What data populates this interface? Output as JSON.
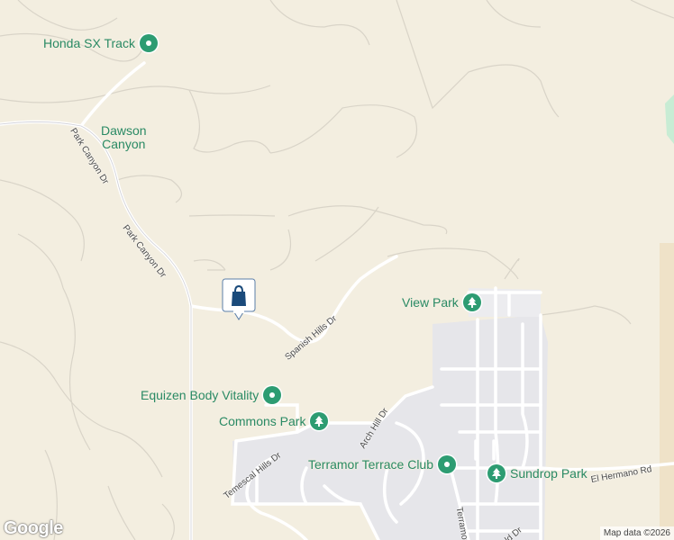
{
  "pois": [
    {
      "id": "honda-sx-track",
      "label": "Honda SX Track",
      "icon": "pin-icon"
    },
    {
      "id": "view-park",
      "label": "View Park",
      "icon": "tree-icon"
    },
    {
      "id": "equizen",
      "label": "Equizen Body Vitality",
      "icon": "pin-icon"
    },
    {
      "id": "commons-park",
      "label": "Commons Park",
      "icon": "tree-icon"
    },
    {
      "id": "terramor-terrace-club",
      "label": "Terramor Terrace Club",
      "icon": "pin-icon"
    },
    {
      "id": "sundrop-park",
      "label": "Sundrop Park",
      "icon": "tree-icon"
    }
  ],
  "area_label": {
    "line1": "Dawson",
    "line2": "Canyon"
  },
  "roads": {
    "park_canyon_1": "Park Canyon Dr",
    "park_canyon_2": "Park Canyon Dr",
    "spanish_hills": "Spanish Hills Dr",
    "arch_hill": "Arch Hill Dr",
    "temescal_hills": "Temescal Hills Dr",
    "el_hermano": "El Hermano Rd",
    "terramor": "Terramor",
    "bottom_dr": "ld Dr"
  },
  "marker": {
    "icon": "shopping-bag-icon"
  },
  "footer": {
    "logo": "Google",
    "attribution": "Map data ©2026"
  },
  "colors": {
    "land": "#f3eee0",
    "road": "#ffffff",
    "poi": "#2d9c72",
    "marker": "#1a4a7a",
    "park": "#c8ecd4"
  }
}
